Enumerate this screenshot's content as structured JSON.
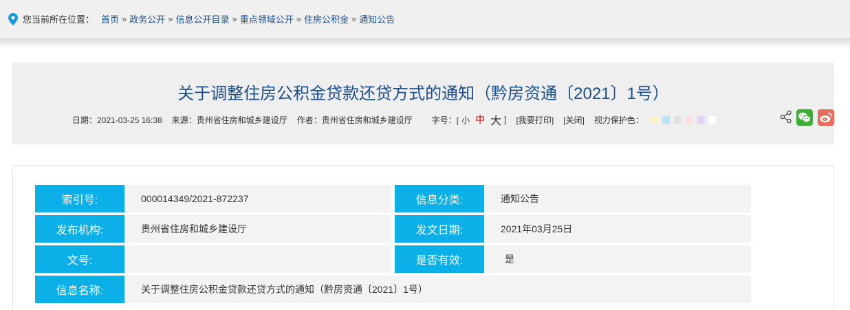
{
  "breadcrumb": {
    "label": "您当前所在位置：",
    "items": [
      "首页",
      "政务公开",
      "信息公开目录",
      "重点领域公开",
      "住房公积金",
      "通知公告"
    ],
    "separator": "»"
  },
  "article": {
    "title": "关于调整住房公积金贷款还贷方式的通知（黔房资通〔2021〕1号）",
    "date": "日期：2021-03-25 16:38",
    "source": "来源：贵州省住房和城乡建设厅",
    "author": "作者：贵州省住房和城乡建设厅",
    "font_label": "字号：[",
    "font_small": "小",
    "font_mid": "中",
    "font_big": "大",
    "font_close": "]",
    "print": "[我要打印]",
    "close": "[关闭]",
    "eye_label": "视力保护色："
  },
  "colors": {
    "accent": "#0bb0e8",
    "title": "#1a4f8a",
    "swatches": [
      "#fbf6c7",
      "#b9e2f6",
      "#e2e2e2",
      "#fbdfe5",
      "#e1d4f5",
      "#ffffff"
    ]
  },
  "info": {
    "index_label": "索引号:",
    "index_value": "000014349/2021-872237",
    "category_label": "信息分类:",
    "category_value": "通知公告",
    "publisher_label": "发布机构:",
    "publisher_value": "贵州省住房和城乡建设厅",
    "date_label": "发文日期:",
    "date_value": "2021年03月25日",
    "doc_label": "文号:",
    "doc_value": "",
    "valid_label": "是否有效:",
    "valid_value": "是",
    "name_label": "信息名称:",
    "name_value": "关于调整住房公积金贷款还贷方式的通知（黔房资通〔2021〕1号）"
  }
}
